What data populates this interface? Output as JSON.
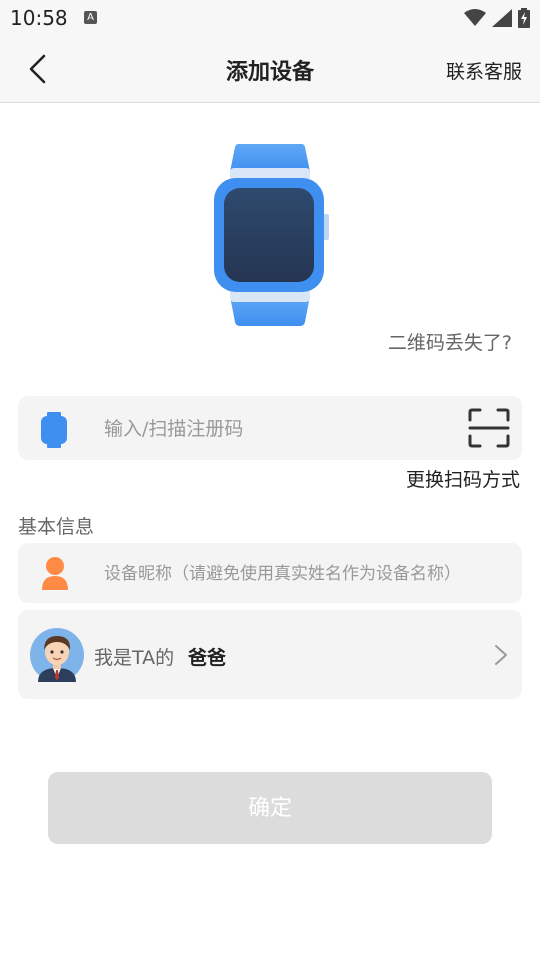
{
  "status_bar": {
    "time": "10:58",
    "notification_badge": "A",
    "icons": [
      "wifi-icon",
      "signal-icon",
      "battery-charging-icon"
    ]
  },
  "header": {
    "back_icon": "chevron-left-icon",
    "title": "添加设备",
    "service_link": "联系客服"
  },
  "hero": {
    "illustration": "smartwatch-icon",
    "qr_lost_link": "二维码丢失了?"
  },
  "register": {
    "placeholder": "输入/扫描注册码",
    "value": "",
    "leading_icon": "watch-icon",
    "scan_icon": "scan-icon",
    "switch_scan_link": "更换扫码方式"
  },
  "basic_info": {
    "section_title": "基本信息",
    "nickname_placeholder": "设备昵称（请避免使用真实姓名作为设备名称）",
    "nickname_value": "",
    "nickname_icon": "person-icon",
    "relation_prefix": "我是TA的",
    "relation_value": "爸爸",
    "relation_avatar": "father-avatar",
    "relation_chevron": "chevron-right-icon"
  },
  "actions": {
    "confirm_label": "确定"
  },
  "colors": {
    "accent_blue": "#3f8ff0",
    "watch_screen": "#2b4466",
    "person_orange": "#ff8a45",
    "confirm_disabled": "#dcdcdc",
    "field_bg": "#f4f4f4"
  }
}
